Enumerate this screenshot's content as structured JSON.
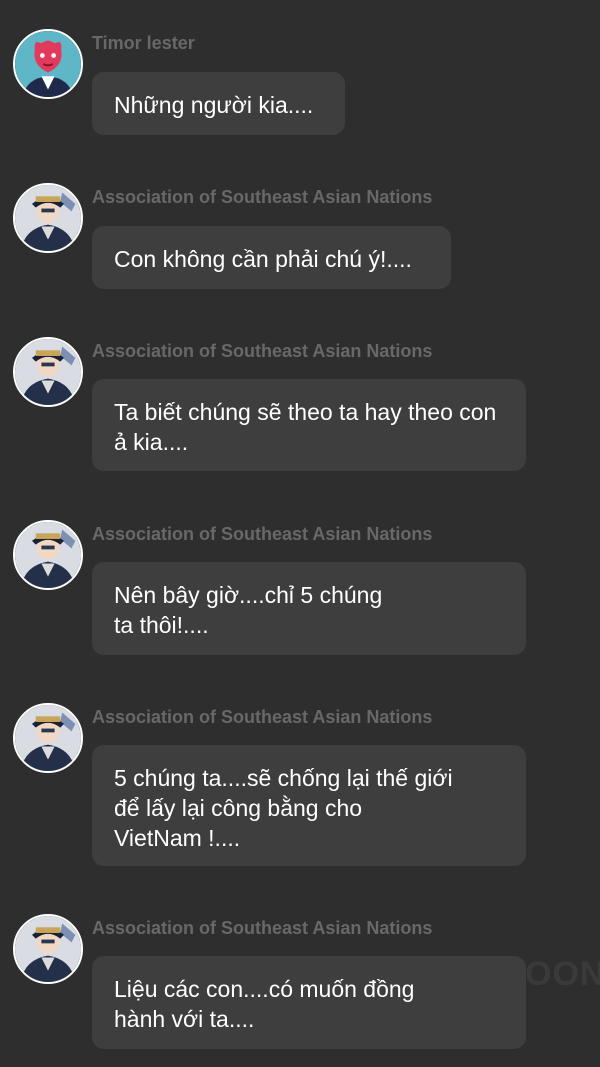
{
  "messages": [
    {
      "sender": "Timor lester",
      "text": "Những người kia....",
      "avatar": "pink-character-avatar-icon"
    },
    {
      "sender": "Association of Southeast Asian Nations",
      "text": "Con không cần phải chú ý!....",
      "avatar": "uniformed-character-avatar-icon"
    },
    {
      "sender": "Association of Southeast Asian Nations",
      "text": "Ta biết chúng sẽ theo ta hay theo con ả kia....",
      "avatar": "uniformed-character-avatar-icon"
    },
    {
      "sender": "Association of Southeast Asian Nations",
      "text": "Nên bây giờ....chỉ 5 chúng ta thôi!....",
      "avatar": "uniformed-character-avatar-icon"
    },
    {
      "sender": "Association of Southeast Asian Nations",
      "text": "5 chúng ta....sẽ chống lại thế giới để lấy lại công bằng cho VietNam !....",
      "avatar": "uniformed-character-avatar-icon"
    },
    {
      "sender": "Association of Southeast Asian Nations",
      "text": "Liệu các con....có muốn đồng hành với ta....",
      "avatar": "uniformed-character-avatar-icon"
    }
  ],
  "watermark": "OON",
  "colors": {
    "background": "#2e2e2e",
    "bubble": "#3e3e3e",
    "sender_text": "#686868",
    "message_text": "#ffffff"
  }
}
